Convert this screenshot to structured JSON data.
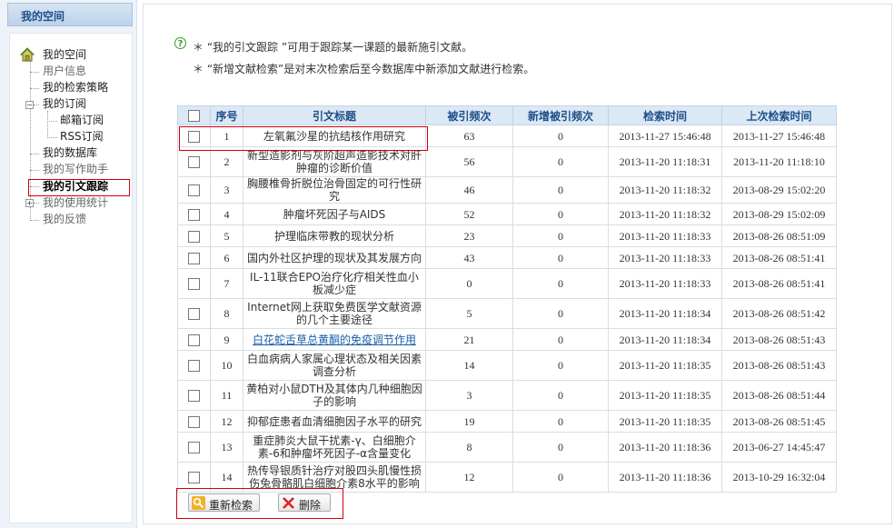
{
  "sidebar": {
    "title": "我的空间",
    "items": [
      {
        "label": "我的空间"
      },
      {
        "label": "用户信息"
      },
      {
        "label": "我的检索策略"
      },
      {
        "label": "我的订阅"
      },
      {
        "label": "邮箱订阅"
      },
      {
        "label": "RSS订阅"
      },
      {
        "label": "我的数据库"
      },
      {
        "label": "我的写作助手"
      },
      {
        "label": "我的引文跟踪"
      },
      {
        "label": "我的使用统计"
      },
      {
        "label": "我的反馈"
      }
    ]
  },
  "notes": {
    "line1": "＊ “我的引文跟踪 ”可用于跟踪某一课题的最新施引文献。",
    "line2": "＊ “新增文献检索”是对末次检索后至今数据库中新添加文献进行检索。"
  },
  "table": {
    "headers": [
      "",
      "序号",
      "引文标题",
      "被引频次",
      "新增被引频次",
      "检索时间",
      "上次检索时间"
    ],
    "rows": [
      {
        "no": "1",
        "title": "左氧氟沙星的抗结核作用研究",
        "cited": "63",
        "new": "0",
        "time": "2013-11-27 15:46:48",
        "last": "2013-11-27 15:46:48"
      },
      {
        "no": "2",
        "title": "新型造影剂与灰阶超声造影技术对肝肿瘤的诊断价值",
        "cited": "56",
        "new": "0",
        "time": "2013-11-20 11:18:31",
        "last": "2013-11-20 11:18:10"
      },
      {
        "no": "3",
        "title": "胸腰椎骨折脱位治骨固定的可行性研究",
        "cited": "46",
        "new": "0",
        "time": "2013-11-20 11:18:32",
        "last": "2013-08-29 15:02:20"
      },
      {
        "no": "4",
        "title": "肿瘤坏死因子与AIDS",
        "cited": "52",
        "new": "0",
        "time": "2013-11-20 11:18:32",
        "last": "2013-08-29 15:02:09"
      },
      {
        "no": "5",
        "title": "护理临床带教的现状分析",
        "cited": "23",
        "new": "0",
        "time": "2013-11-20 11:18:33",
        "last": "2013-08-26 08:51:09"
      },
      {
        "no": "6",
        "title": "国内外社区护理的现状及其发展方向",
        "cited": "43",
        "new": "0",
        "time": "2013-11-20 11:18:33",
        "last": "2013-08-26 08:51:41"
      },
      {
        "no": "7",
        "title": "IL-11联合EPO治疗化疗相关性血小板减少症",
        "cited": "0",
        "new": "0",
        "time": "2013-11-20 11:18:33",
        "last": "2013-08-26 08:51:41"
      },
      {
        "no": "8",
        "title": "Internet网上获取免费医学文献资源的几个主要途径",
        "cited": "5",
        "new": "0",
        "time": "2013-11-20 11:18:34",
        "last": "2013-08-26 08:51:42"
      },
      {
        "no": "9",
        "title": "白花蛇舌草总黄酮的免疫调节作用",
        "cited": "21",
        "new": "0",
        "time": "2013-11-20 11:18:34",
        "last": "2013-08-26 08:51:43"
      },
      {
        "no": "10",
        "title": "白血病病人家属心理状态及相关因素调查分析",
        "cited": "14",
        "new": "0",
        "time": "2013-11-20 11:18:35",
        "last": "2013-08-26 08:51:43"
      },
      {
        "no": "11",
        "title": "黄柏对小鼠DTH及其体内几种细胞因子的影响",
        "cited": "3",
        "new": "0",
        "time": "2013-11-20 11:18:35",
        "last": "2013-08-26 08:51:44"
      },
      {
        "no": "12",
        "title": "抑郁症患者血清细胞因子水平的研究",
        "cited": "19",
        "new": "0",
        "time": "2013-11-20 11:18:35",
        "last": "2013-08-26 08:51:45"
      },
      {
        "no": "13",
        "title": "重症肺炎大鼠干扰素-γ、白细胞介素-6和肿瘤坏死因子-α含量变化",
        "cited": "8",
        "new": "0",
        "time": "2013-11-20 11:18:36",
        "last": "2013-06-27 14:45:47"
      },
      {
        "no": "14",
        "title": "热传导银质针治疗对股四头肌慢性损伤兔骨骼肌白细胞介素8水平的影响",
        "cited": "12",
        "new": "0",
        "time": "2013-11-20 11:18:36",
        "last": "2013-10-29 16:32:04"
      }
    ]
  },
  "buttons": {
    "research": "重新检索",
    "delete": "删除"
  },
  "icons": {
    "home": "home-icon",
    "help": "help-icon",
    "search": "search-icon",
    "delete": "delete-icon"
  },
  "colors": {
    "accent": "#1e4e86",
    "highlight": "#d0000c",
    "header_bg": "#dbe8f5"
  }
}
